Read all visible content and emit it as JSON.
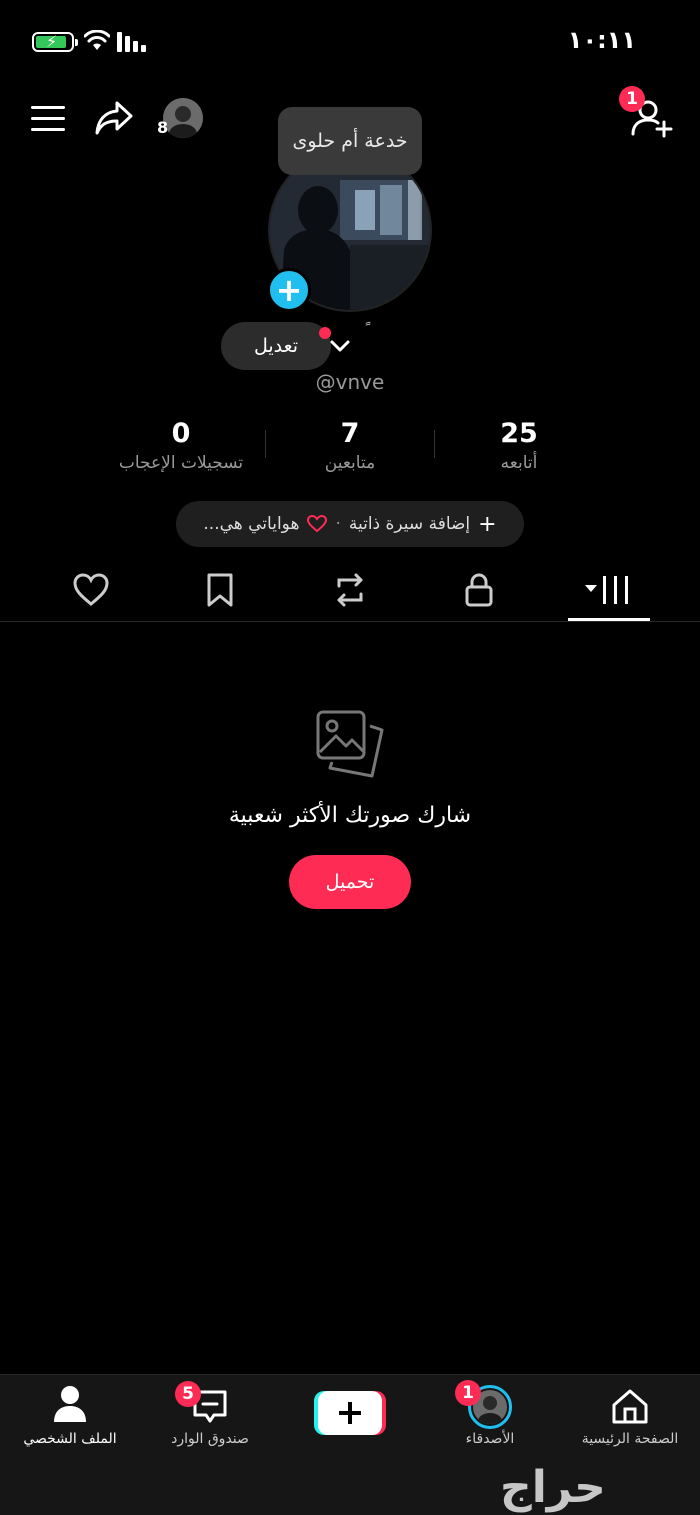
{
  "status_bar": {
    "time": "١٠:١١",
    "battery": "charging"
  },
  "header": {
    "followers_count_badge": "8",
    "add_friend_badge": "1",
    "tooltip": "خدعة أم حلوى"
  },
  "profile": {
    "edit_label": "تعديل",
    "nickname": "ً",
    "username": "@vnve"
  },
  "stats": [
    {
      "value": "25",
      "label": "أتابعه"
    },
    {
      "value": "7",
      "label": "متابعين"
    },
    {
      "value": "0",
      "label": "تسجيلات الإعجاب"
    }
  ],
  "bio": {
    "add_label": "إضافة سيرة ذاتية",
    "separator": "·",
    "hobbies": "هواياتي هي..."
  },
  "tabs": [
    "videos-grid",
    "private",
    "reposts",
    "favorites",
    "liked"
  ],
  "empty_state": {
    "message": "شارك صورتك الأكثر شعبية",
    "upload_label": "تحميل"
  },
  "bottom_nav": {
    "home": "الصفحة الرئيسية",
    "friends": "الأصدقاء",
    "friends_badge": "1",
    "inbox": "صندوق الوارد",
    "inbox_badge": "5",
    "profile": "الملف الشخصي"
  },
  "watermark": "حراج",
  "colors": {
    "accent": "#fe2c55",
    "cyan": "#20bff0",
    "battery": "#34c759"
  }
}
